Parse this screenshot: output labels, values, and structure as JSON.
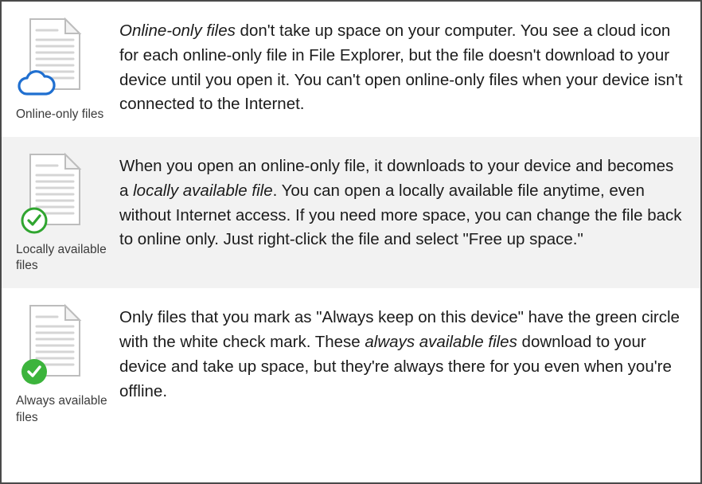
{
  "rows": [
    {
      "caption": "Online-only files",
      "desc_prefix_em": "Online-only files",
      "desc_part1": " don't take up space on your computer. You see a cloud icon for each online-only file in File Explorer, but the file doesn't download to your device until you open it. You can't open online-only files when your device isn't connected to the Internet."
    },
    {
      "caption": "Locally available files",
      "desc_pre": "When you open an online-only file, it downloads to your device and becomes a ",
      "desc_em": "locally available file",
      "desc_post": ". You can open a locally available file anytime, even without Internet access. If you need more space, you can change the file back to online only. Just right-click the file and select \"Free up space.\""
    },
    {
      "caption": "Always available files",
      "desc_pre": "Only files that you mark as \"Always keep on this device\" have the green circle with the white check mark. These ",
      "desc_em": "always available files",
      "desc_post": " download to your device and take up space, but they're always there for you even when you're offline."
    }
  ]
}
